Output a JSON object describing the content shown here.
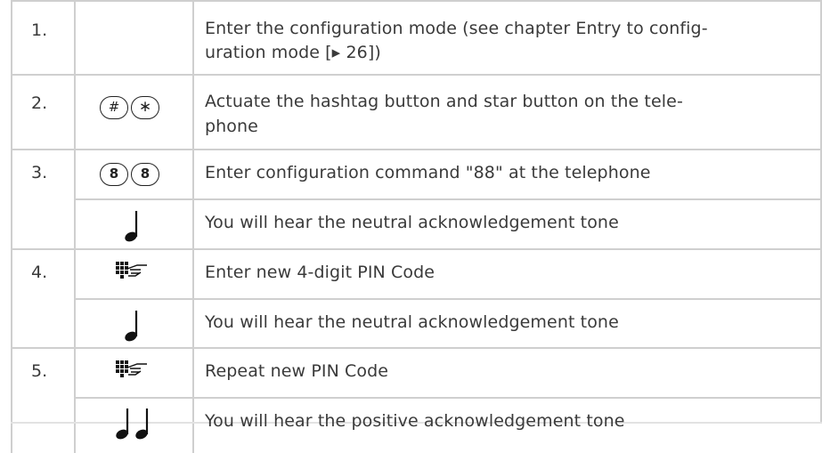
{
  "steps": [
    {
      "num": "1.",
      "icon": "none-icon",
      "lines": [
        "Enter the configuration mode (see chapter Entry to config-",
        "uration mode [▸ 26])"
      ]
    },
    {
      "num": "2.",
      "icon": "hash-star-keys-icon",
      "keys": [
        "#",
        "∗"
      ],
      "lines": [
        "Actuate the hashtag button and star button on the tele-",
        "phone"
      ]
    },
    {
      "num": "3.",
      "icon": "eight-eight-keys-icon",
      "keys": [
        "8",
        "8"
      ],
      "lines": [
        "Enter configuration command \"88\" at the telephone"
      ]
    },
    {
      "num": "",
      "icon": "single-note-icon",
      "lines": [
        "You will hear the neutral acknowledgement tone"
      ]
    },
    {
      "num": "4.",
      "icon": "keypad-hand-icon",
      "lines": [
        "Enter new 4-digit PIN Code"
      ]
    },
    {
      "num": "",
      "icon": "single-note-icon",
      "lines": [
        "You will hear the neutral acknowledgement tone"
      ]
    },
    {
      "num": "5.",
      "icon": "keypad-hand-icon",
      "lines": [
        "Repeat new PIN Code"
      ]
    },
    {
      "num": "",
      "icon": "double-note-icon",
      "lines": [
        "You will hear the positive acknowledgement tone"
      ]
    }
  ]
}
